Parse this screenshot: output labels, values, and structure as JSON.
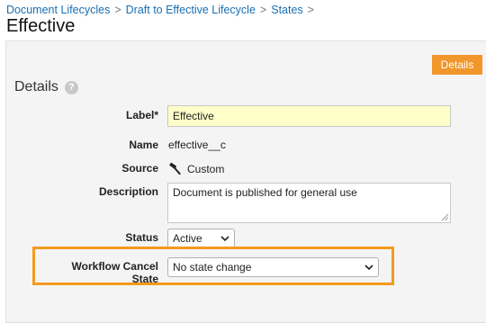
{
  "breadcrumb": {
    "items": [
      "Document Lifecycles",
      "Draft to Effective Lifecycle",
      "States"
    ],
    "separator": ">"
  },
  "page": {
    "title": "Effective"
  },
  "tabs": {
    "details": "Details"
  },
  "section": {
    "heading": "Details",
    "help_icon": "question-mark-icon"
  },
  "fields": {
    "label": {
      "label": "Label*",
      "value": "Effective"
    },
    "name": {
      "label": "Name",
      "value": "effective__c"
    },
    "source": {
      "label": "Source",
      "value": "Custom",
      "icon": "hammer-icon"
    },
    "description": {
      "label": "Description",
      "value": "Document is published for general use"
    },
    "status": {
      "label": "Status",
      "value": "Active"
    },
    "workflow_cancel_state": {
      "label": "Workflow Cancel State",
      "value": "No state change"
    }
  },
  "colors": {
    "accent_orange": "#f0962a",
    "highlight_border": "#f39a1e",
    "link_blue": "#1a6fb3",
    "input_yellow": "#ffffc9",
    "panel_bg": "#f4f4f4"
  }
}
